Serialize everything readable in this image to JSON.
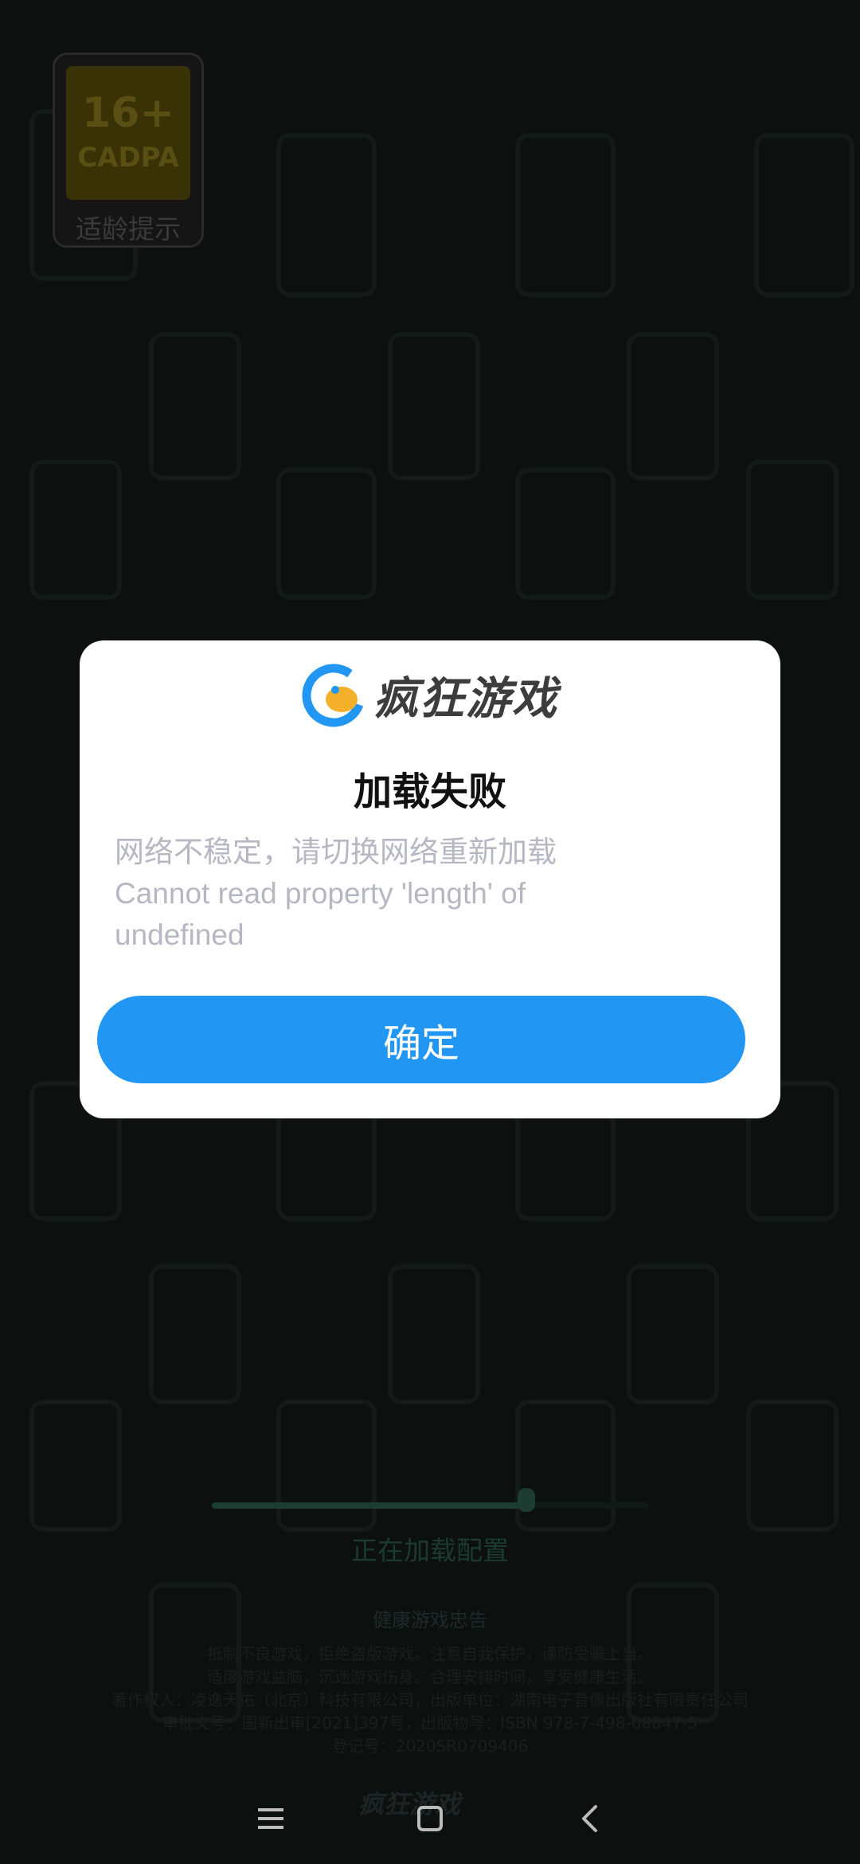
{
  "age_badge": {
    "age": "16+",
    "org": "CADPA",
    "hint": "适龄提示"
  },
  "loading": {
    "text": "正在加载配置",
    "progress": 0.72
  },
  "health": {
    "title": "健康游戏忠告",
    "lines": [
      "抵制不良游戏，拒绝盗版游戏。注意自我保护，谨防受骗上当。",
      "适度游戏益脑，沉迷游戏伤身。合理安排时间，享受健康生活。",
      "著作权人：凌逸天佑（北京）科技有限公司，出版单位：湖南电子音像出版社有限责任公司",
      "审批文号：国新出审[2021]397号，出版物号：ISBN 978-7-498-08847-5",
      "登记号：2020SR0709406"
    ]
  },
  "footer_logo": "疯狂游戏",
  "dialog": {
    "brand": "疯狂游戏",
    "title": "加载失败",
    "message_line1": "网络不稳定，请切换网络重新加载",
    "message_line2": "Cannot read property 'length' of",
    "message_line3": "undefined",
    "confirm_label": "确定",
    "accent": "#2196f3"
  },
  "navbar": {
    "icons": [
      "menu-icon",
      "home-icon",
      "back-icon"
    ]
  }
}
